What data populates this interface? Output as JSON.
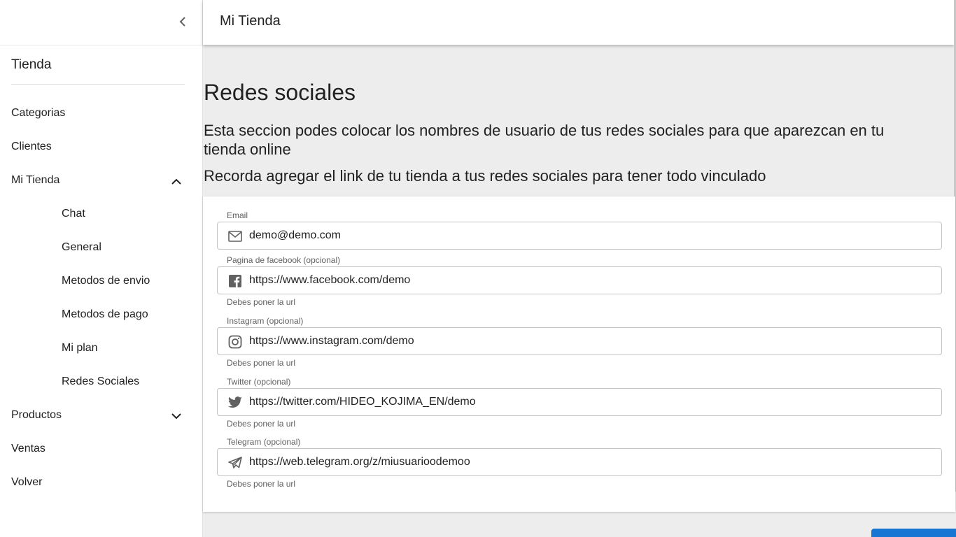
{
  "sidebar": {
    "collapse_icon": "chevron-left-icon",
    "store_title": "Tienda",
    "items": [
      {
        "label": "Categorias"
      },
      {
        "label": "Clientes"
      },
      {
        "label": "Mi Tienda",
        "expanded": true,
        "icon": "chevron-up-icon"
      },
      {
        "label": "Chat"
      },
      {
        "label": "General"
      },
      {
        "label": "Metodos de envio"
      },
      {
        "label": "Metodos de pago"
      },
      {
        "label": "Mi plan"
      },
      {
        "label": "Redes Sociales"
      },
      {
        "label": "Productos",
        "expanded": false,
        "icon": "chevron-down-icon"
      },
      {
        "label": "Ventas"
      },
      {
        "label": "Volver"
      }
    ]
  },
  "appbar": {
    "title": "Mi Tienda"
  },
  "main": {
    "title": "Redes sociales",
    "description": "Esta seccion podes colocar los nombres de usuario de tus redes sociales para que aparezcan en tu tienda online",
    "reminder": "Recorda agregar el link de tu tienda a tus redes sociales para tener todo vinculado",
    "fields": [
      {
        "label": "Email",
        "value": "demo@demo.com",
        "icon": "mail-icon",
        "helper": ""
      },
      {
        "label": "Pagina de facebook (opcional)",
        "value": "https://www.facebook.com/demo",
        "icon": "facebook-icon",
        "helper": "Debes poner la url"
      },
      {
        "label": "Instagram (opcional)",
        "value": "https://www.instagram.com/demo",
        "icon": "instagram-icon",
        "helper": "Debes poner la url"
      },
      {
        "label": "Twitter (opcional)",
        "value": "https://twitter.com/HIDEO_KOJIMA_EN/demo",
        "icon": "twitter-icon",
        "helper": "Debes poner la url"
      },
      {
        "label": "Telegram (opcional)",
        "value": "https://web.telegram.org/z/miusuarioodemoo",
        "icon": "telegram-icon",
        "helper": "Debes poner la url"
      }
    ]
  },
  "colors": {
    "primary": "#1976d2",
    "background": "#ededed"
  }
}
